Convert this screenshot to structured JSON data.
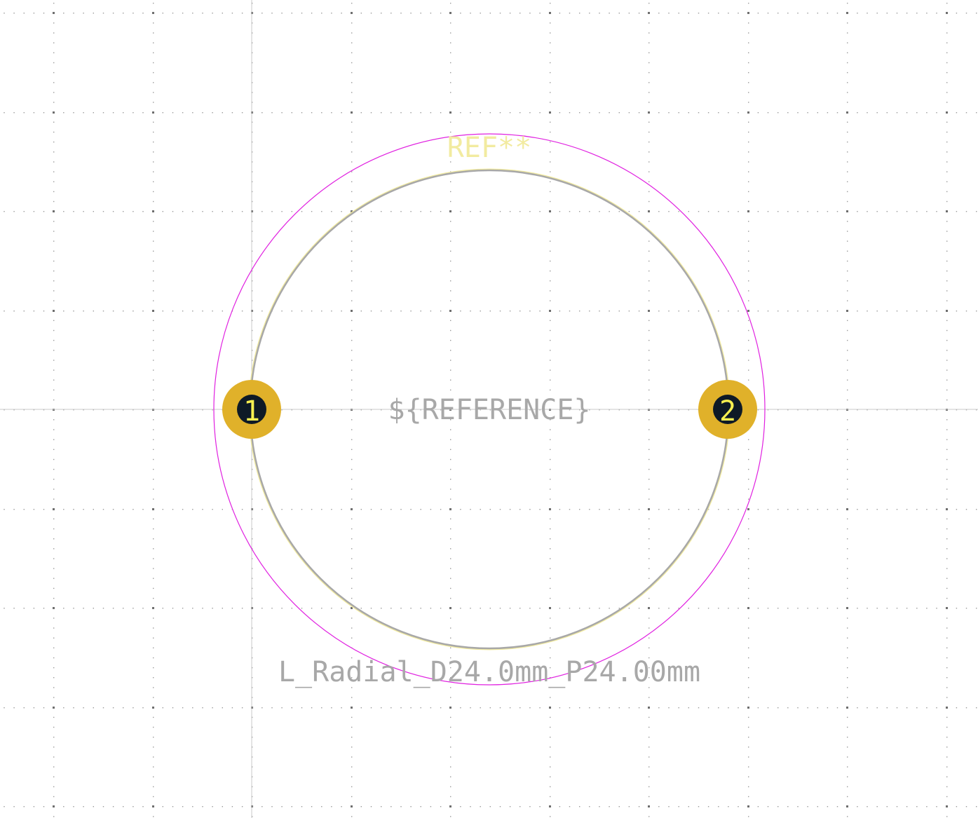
{
  "footprint": {
    "reference_label": "REF**",
    "value_label": "${REFERENCE}",
    "footprint_name": "L_Radial_D24.0mm_P24.00mm"
  },
  "pads": [
    {
      "number": "1"
    },
    {
      "number": "2"
    }
  ],
  "colors": {
    "background": "#ffffff",
    "grid_dot": "#9a9a9a",
    "axis_line": "#c8c8c8",
    "courtyard": "#e020e0",
    "silkscreen": "#f2eba0",
    "fabrication": "#a8a8a8",
    "pad_copper": "#e0b12a",
    "pad_hole": "#0e1a26",
    "pad_number": "#f7f050"
  }
}
